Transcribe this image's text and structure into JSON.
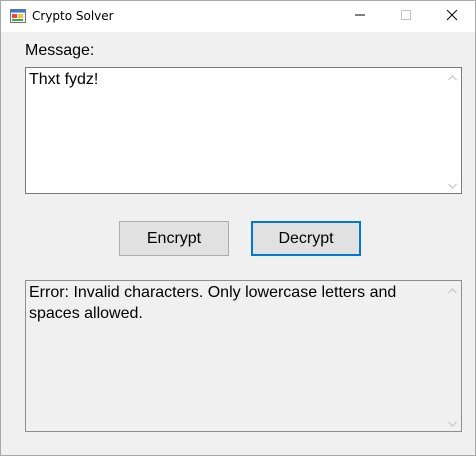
{
  "window": {
    "title": "Crypto Solver",
    "controls": {
      "minimize": "minimize-icon",
      "maximize": "maximize-icon",
      "close": "close-icon"
    }
  },
  "message": {
    "label": "Message:",
    "value": "Thxt fydz!"
  },
  "buttons": {
    "encrypt": "Encrypt",
    "decrypt": "Decrypt"
  },
  "output": {
    "value": "Error: Invalid characters. Only lowercase letters and spaces allowed."
  },
  "colors": {
    "focus_border": "#0078d7",
    "window_bg": "#f0f0f0",
    "button_bg": "#e1e1e1"
  }
}
